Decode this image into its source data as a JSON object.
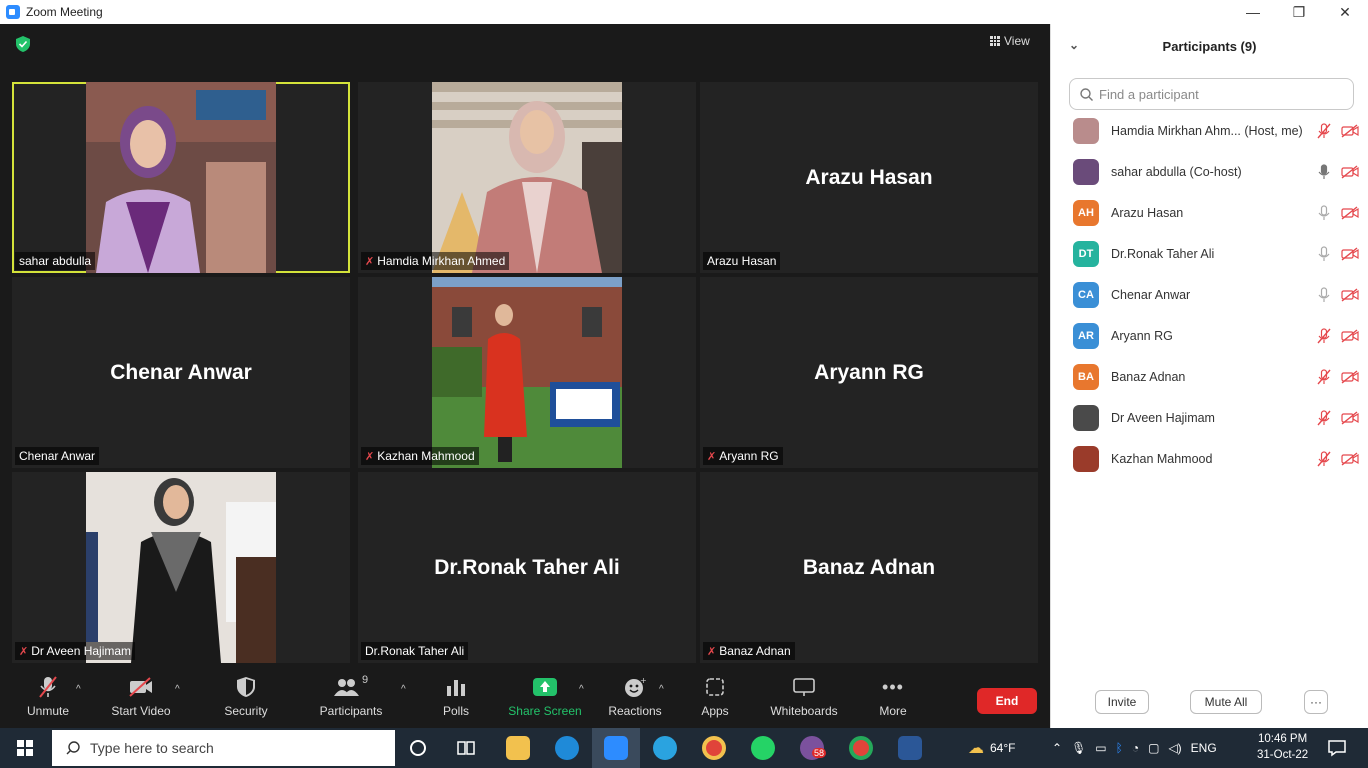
{
  "window": {
    "title": "Zoom Meeting",
    "controls": {
      "minimize": "—",
      "restore": "❐",
      "close": "✕"
    }
  },
  "meeting": {
    "view_label": "View",
    "tiles": [
      {
        "name": "sahar abdulla",
        "show_big_name": false,
        "muted": false,
        "active": true,
        "has_video": true
      },
      {
        "name": "Hamdia Mirkhan Ahmed",
        "show_big_name": false,
        "muted": true,
        "active": false,
        "has_video": true
      },
      {
        "name": "Arazu Hasan",
        "show_big_name": true,
        "muted": false,
        "active": false,
        "has_video": false
      },
      {
        "name": "Chenar Anwar",
        "show_big_name": true,
        "muted": false,
        "active": false,
        "has_video": false
      },
      {
        "name": "Kazhan Mahmood",
        "show_big_name": false,
        "muted": true,
        "active": false,
        "has_video": true
      },
      {
        "name": "Aryann RG",
        "show_big_name": true,
        "muted": true,
        "active": false,
        "has_video": false
      },
      {
        "name": "Dr Aveen Hajimam",
        "show_big_name": false,
        "muted": true,
        "active": false,
        "has_video": true
      },
      {
        "name": "Dr.Ronak Taher Ali",
        "show_big_name": true,
        "muted": false,
        "active": false,
        "has_video": false
      },
      {
        "name": "Banaz Adnan",
        "show_big_name": true,
        "muted": true,
        "active": false,
        "has_video": false
      }
    ]
  },
  "toolbar": {
    "unmute": "Unmute",
    "start_video": "Start Video",
    "security": "Security",
    "participants": "Participants",
    "participants_count": "9",
    "polls": "Polls",
    "share_screen": "Share Screen",
    "reactions": "Reactions",
    "apps": "Apps",
    "whiteboards": "Whiteboards",
    "more": "More",
    "end": "End"
  },
  "panel": {
    "title": "Participants (9)",
    "search_placeholder": "Find a participant",
    "participants": [
      {
        "name": "Hamdia Mirkhan Ahm... (Host, me)",
        "initials": "",
        "avatar_color": "#b98c8c",
        "photo": true,
        "mic": "muted",
        "video": "off"
      },
      {
        "name": "sahar abdulla (Co-host)",
        "initials": "",
        "avatar_color": "#6a4b7a",
        "photo": true,
        "mic": "on",
        "video": "off"
      },
      {
        "name": "Arazu Hasan",
        "initials": "AH",
        "avatar_color": "#e8772e",
        "photo": false,
        "mic": "idle",
        "video": "off"
      },
      {
        "name": "Dr.Ronak Taher Ali",
        "initials": "DT",
        "avatar_color": "#25b39e",
        "photo": false,
        "mic": "idle",
        "video": "off"
      },
      {
        "name": "Chenar Anwar",
        "initials": "CA",
        "avatar_color": "#3a8fd6",
        "photo": false,
        "mic": "idle",
        "video": "off"
      },
      {
        "name": "Aryann RG",
        "initials": "AR",
        "avatar_color": "#3a8fd6",
        "photo": false,
        "mic": "muted",
        "video": "off"
      },
      {
        "name": "Banaz Adnan",
        "initials": "BA",
        "avatar_color": "#e8772e",
        "photo": false,
        "mic": "muted",
        "video": "off"
      },
      {
        "name": "Dr Aveen Hajimam",
        "initials": "",
        "avatar_color": "#4a4a4a",
        "photo": true,
        "mic": "muted",
        "video": "off"
      },
      {
        "name": "Kazhan Mahmood",
        "initials": "",
        "avatar_color": "#9a3b2a",
        "photo": true,
        "mic": "muted",
        "video": "off"
      }
    ],
    "invite": "Invite",
    "mute_all": "Mute All",
    "more": "···"
  },
  "taskbar": {
    "search_placeholder": "Type here to search",
    "weather": "64°F",
    "language": "ENG",
    "time": "10:46 PM",
    "date": "31-Oct-22",
    "viber_badge": "58"
  },
  "colors": {
    "accent_blue": "#2D8CFF",
    "end_red": "#E02828",
    "share_green": "#23c26a",
    "active_border": "#d4e33a",
    "muted_red": "#e5484d"
  }
}
